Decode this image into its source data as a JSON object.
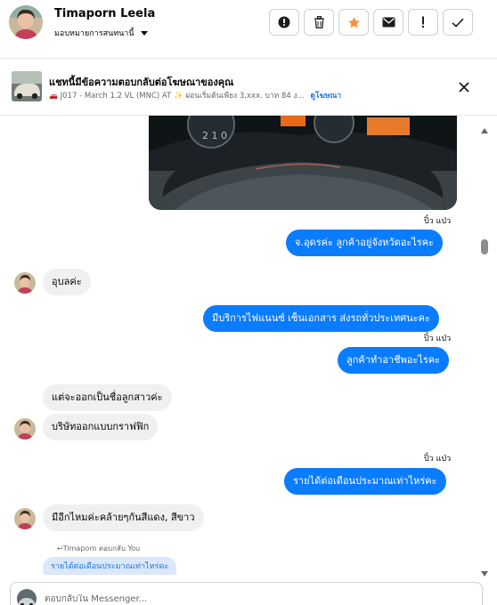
{
  "header": {
    "contact_name": "Timaporn Leela",
    "assign_label": "มอบหมายการสนทนานี้",
    "actions": [
      {
        "name": "report-icon",
        "label": "report"
      },
      {
        "name": "trash-icon",
        "label": "delete"
      },
      {
        "name": "star-icon",
        "label": "star"
      },
      {
        "name": "mail-icon",
        "label": "mark unread"
      },
      {
        "name": "exclamation-icon",
        "label": "spam"
      },
      {
        "name": "check-icon",
        "label": "done"
      }
    ],
    "star_color": "#f7923b"
  },
  "ad": {
    "title": "แชทนี้มีข้อความตอบกลับต่อโฆษณาของคุณ",
    "subtitle": "J017 - March 1.2 VL (MNC) AT ✨ ผ่อนเริ่มต้นเพียง 3,xxx. บาท 84 ง...",
    "link": "ดูโฆษณา"
  },
  "messages": {
    "seen_1": "ปิ๋ว แป่ว",
    "out_1": "จ.อุดรค่ะ  ลูกค้าอยู่จังหวัดอะไรคะ",
    "in_1": "อุบลค่ะ",
    "out_2": "มีบริการไฟแนนซ์ เซ็นเอกสาร ส่งรถทั่วประเทศนะคะ",
    "seen_2": "ปิ๋ว แป่ว",
    "out_3": "ลูกค้าทำอาชีพอะไรคะ",
    "in_2": "แต่จะออกเป็นชื่อลูกสาวค่ะ",
    "in_3": "บริษัทออกแบบกราฟฟิก",
    "seen_3": "ปิ๋ว แป่ว",
    "out_4": "รายได้ต่อเดือนประมาณเท่าไหร่คะ",
    "in_4": "มีอีกไหมค่ะคล้ายๆกันสีแดง, สีขาว",
    "reply_label": "↩Timaporn ตอบกลับ You",
    "reply_quote": "รายได้ต่อเดือนประมาณเท่าไหร่คะ"
  },
  "composer": {
    "placeholder": "ตอบกลับใน Messenger..."
  },
  "colors": {
    "accent": "#0a7cff",
    "incoming_bg": "#f0f0f0",
    "reply_bg": "#dbe7fb"
  }
}
